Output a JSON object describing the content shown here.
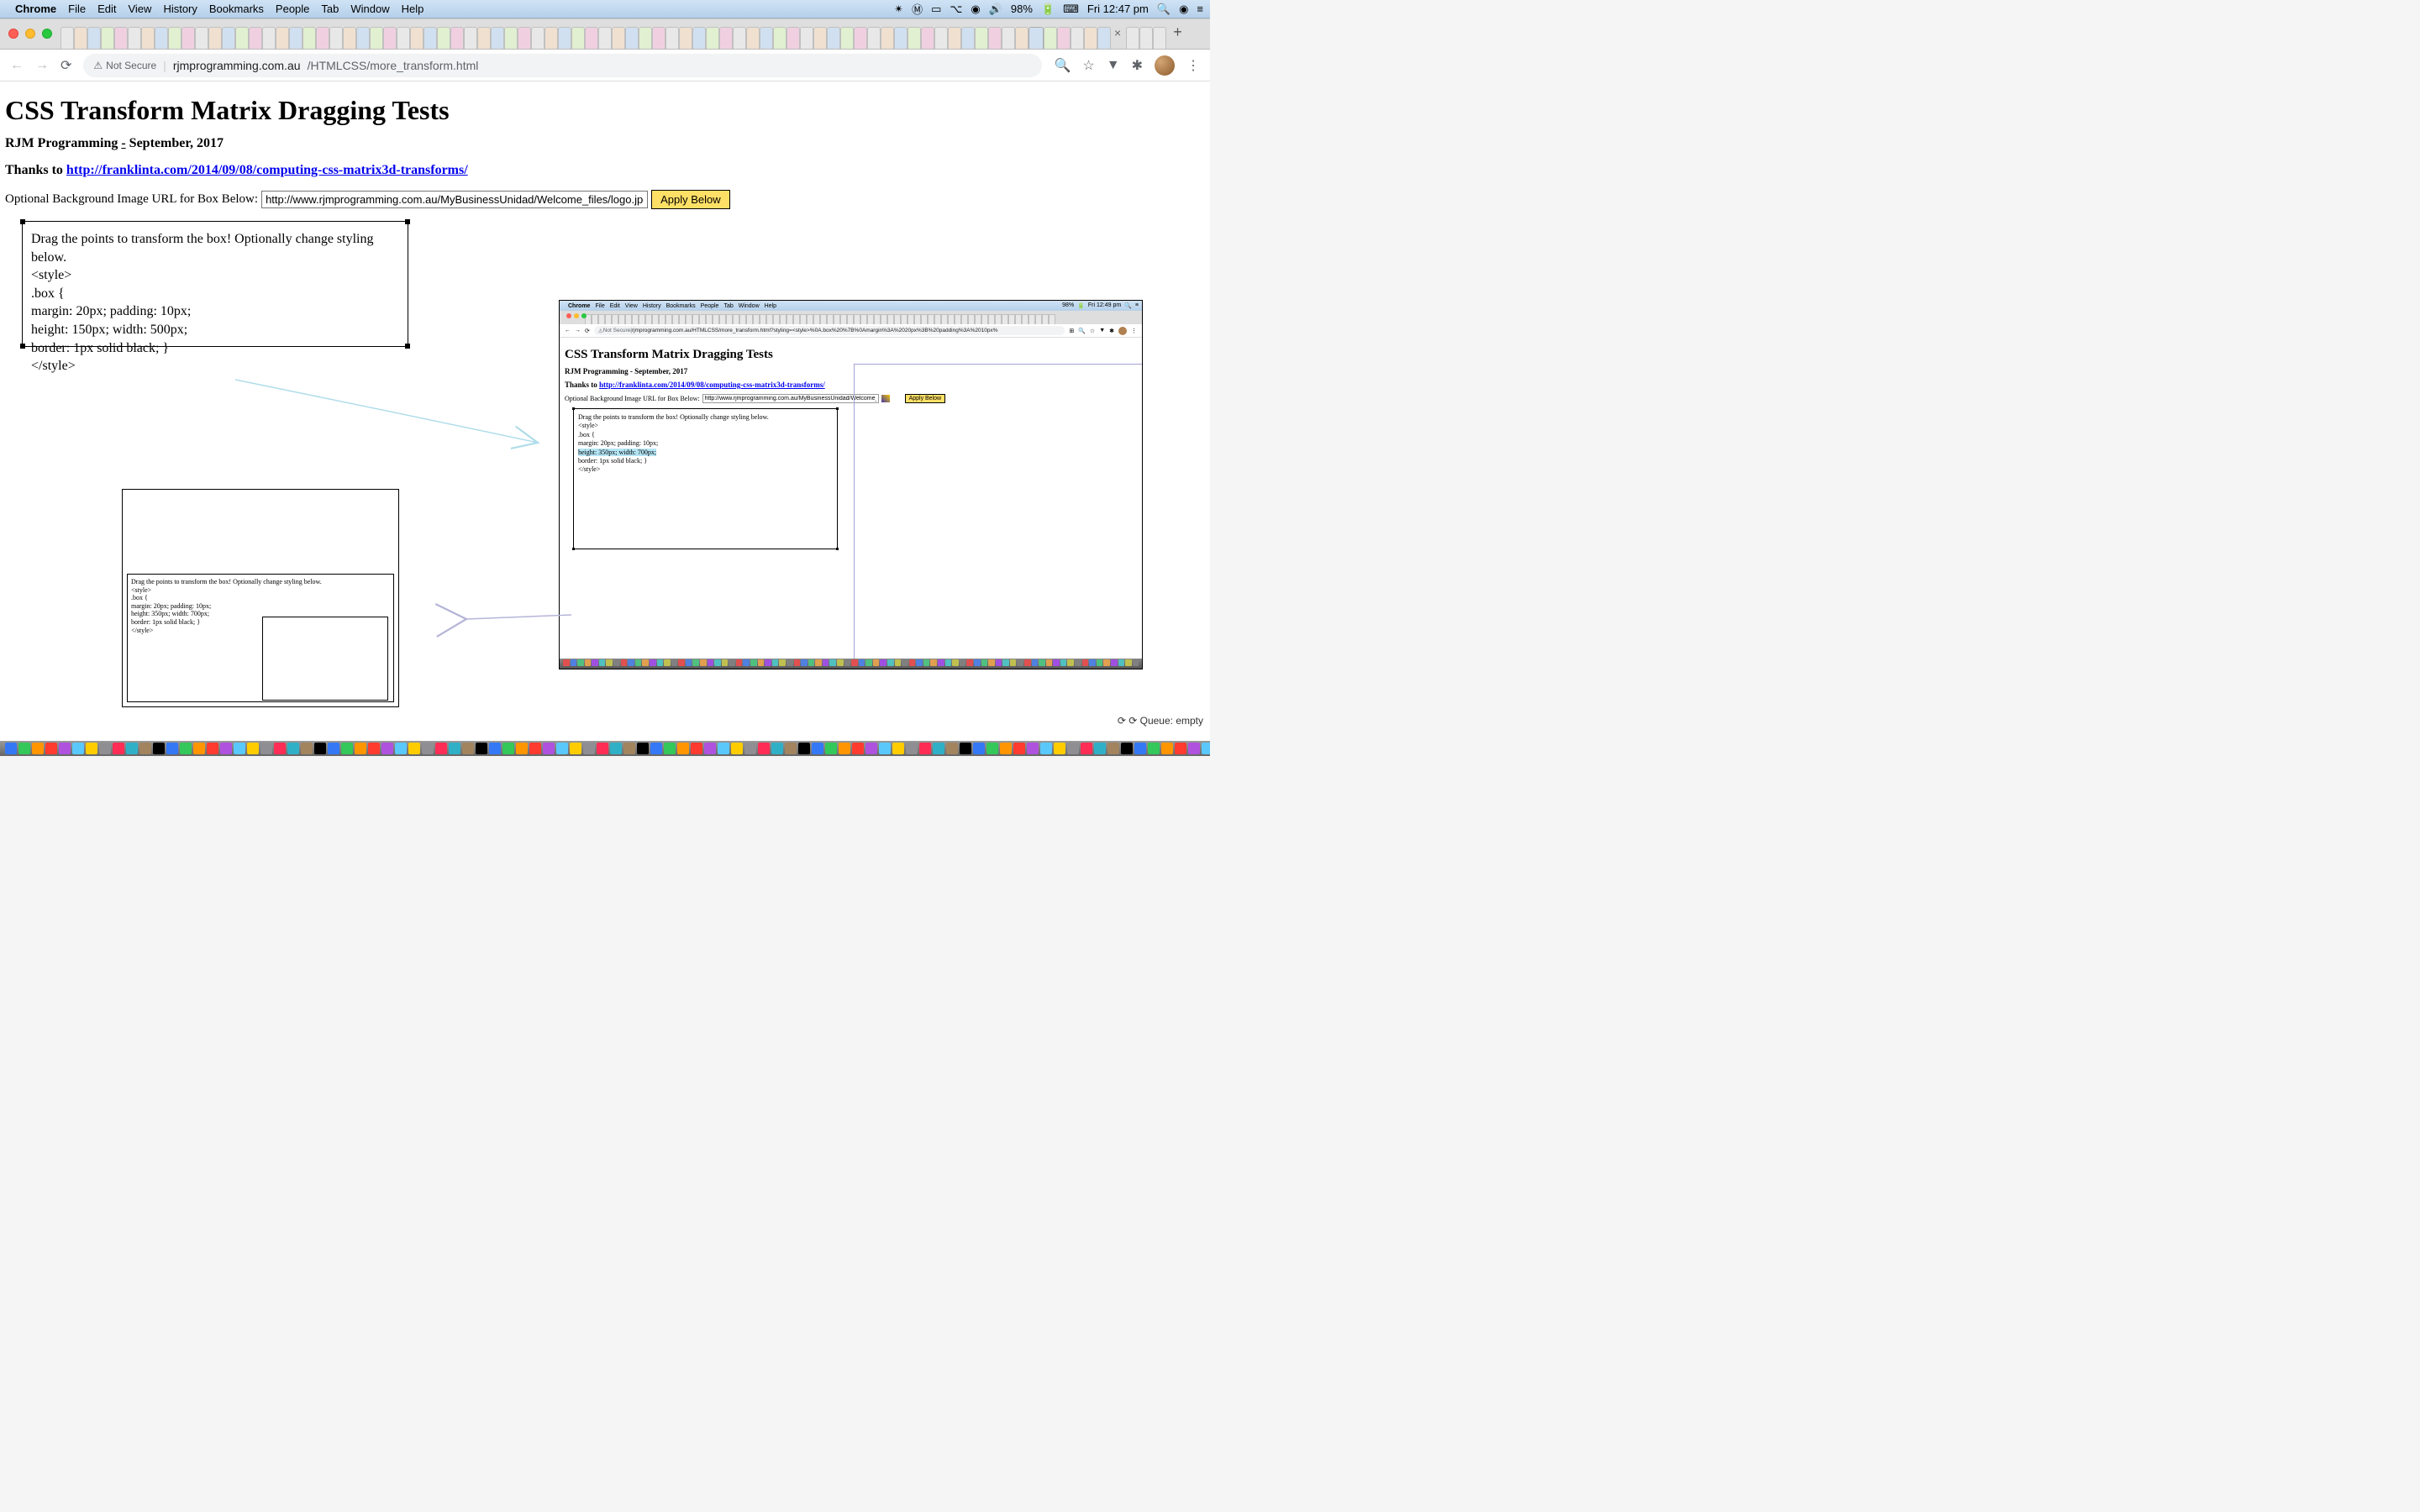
{
  "menubar": {
    "app": "Chrome",
    "items": [
      "File",
      "Edit",
      "View",
      "History",
      "Bookmarks",
      "People",
      "Tab",
      "Window",
      "Help"
    ],
    "battery": "98%",
    "clock": "Fri 12:47 pm"
  },
  "toolbar": {
    "secure_label": "Not Secure",
    "host": "rjmprogramming.com.au",
    "path": "/HTMLCSS/more_transform.html"
  },
  "page": {
    "title": "CSS Transform Matrix Dragging Tests",
    "subtitle_prefix": "RJM Programming ",
    "subtitle_dash": "-",
    "subtitle_suffix": " September, 2017",
    "thanks_prefix": "Thanks to ",
    "thanks_link": "http://franklinta.com/2014/09/08/computing-css-matrix3d-transforms/",
    "bg_label": "Optional Background Image URL for Box Below: ",
    "bg_value": "http://www.rjmprogramming.com.au/MyBusinessUnidad/Welcome_files/logo.jpg",
    "apply_label": "Apply Below",
    "box_lines": [
      "Drag the points to transform the box! Optionally change styling below.",
      "<style>",
      ".box {",
      "margin: 20px; padding: 10px;",
      "height: 150px; width: 500px;",
      "border: 1px solid black; }",
      "</style>"
    ]
  },
  "thumb": {
    "lines": [
      "Drag the points to transform the box! Optionally change styling below.",
      "<style>",
      ".box {",
      "margin: 20px; padding: 10px;",
      "height: 350px; width: 700px;",
      "border: 1px solid black; }",
      "</style>"
    ]
  },
  "nested": {
    "menubar": {
      "app": "Chrome",
      "items": [
        "File",
        "Edit",
        "View",
        "History",
        "Bookmarks",
        "People",
        "Tab",
        "Window",
        "Help"
      ],
      "battery": "98%",
      "clock": "Fri 12:49 pm"
    },
    "toolbar": {
      "secure_label": "Not Secure",
      "url": "rjmprogramming.com.au/HTMLCSS/more_transform.html?styling=<style>%0A.box%20%7B%0Amargin%3A%2020px%3B%20padding%3A%2010px%"
    },
    "page": {
      "title": "CSS Transform Matrix Dragging Tests",
      "subtitle": "RJM Programming - September, 2017",
      "thanks_prefix": "Thanks to ",
      "thanks_link": "http://franklinta.com/2014/09/08/computing-css-matrix3d-transforms/",
      "bg_label": "Optional Background Image URL for Box Below: ",
      "bg_value": "http://www.rjmprogramming.com.au/MyBusinessUnidad/Welcome_files/logo.jpg",
      "apply_label": "Apply Below",
      "box_lines": [
        "Drag the points to transform the box! Optionally change styling below.",
        "<style>",
        ".box {",
        "margin: 20px; padding: 10px;",
        "height: 350px; width: 700px;",
        "border: 1px solid black; }",
        "</style>"
      ],
      "highlight_line_index": 4
    }
  },
  "status": {
    "queue": "Queue: empty"
  }
}
